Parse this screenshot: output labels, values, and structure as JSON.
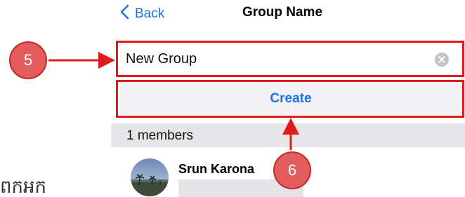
{
  "nav": {
    "back_label": "Back",
    "title": "Group Name"
  },
  "group_name_field": {
    "value": "New Group"
  },
  "create_button": {
    "label": "Create"
  },
  "members_section": {
    "header": "1 members",
    "members": [
      {
        "name": "Srun Karona"
      }
    ]
  },
  "background_text": "ពកអក",
  "annotations": {
    "markers": [
      "5",
      "6"
    ],
    "color": "#e01b1b"
  },
  "colors": {
    "accent": "#1a73e8",
    "marker_fill": "#e35d5d"
  }
}
